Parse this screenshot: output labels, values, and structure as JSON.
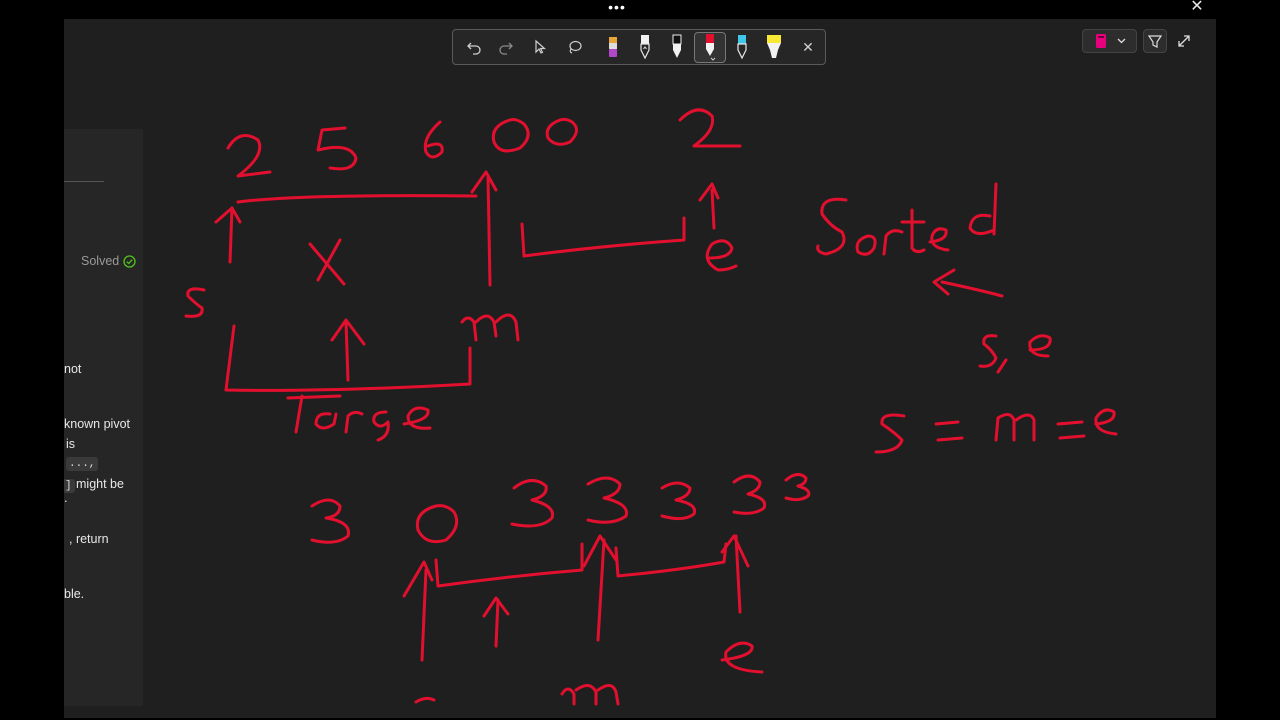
{
  "window": {
    "overflow_label": "•••",
    "close_label": "✕"
  },
  "problem_panel": {
    "status": "Solved",
    "lines": [
      "not",
      "known pivot",
      "is",
      "might be",
      ".",
      ", return",
      "ble."
    ],
    "code_chips": [
      "...,",
      "]"
    ]
  },
  "pen_toolbar": {
    "items": [
      {
        "name": "undo-icon"
      },
      {
        "name": "redo-icon"
      },
      {
        "name": "select-icon"
      },
      {
        "name": "lasso-icon"
      },
      {
        "name": "eraser-icon"
      },
      {
        "name": "pen-white-icon"
      },
      {
        "name": "pen-black-icon"
      },
      {
        "name": "pen-red-icon",
        "selected": true
      },
      {
        "name": "pen-cyan-icon"
      },
      {
        "name": "highlighter-yellow-icon"
      },
      {
        "name": "close-icon"
      }
    ],
    "close_label": "✕"
  },
  "controls": {
    "ink_color": "#e6007e"
  },
  "colors": {
    "ink": "#e2102e",
    "background": "#1f1f1f",
    "solved_check": "#52c41a"
  }
}
